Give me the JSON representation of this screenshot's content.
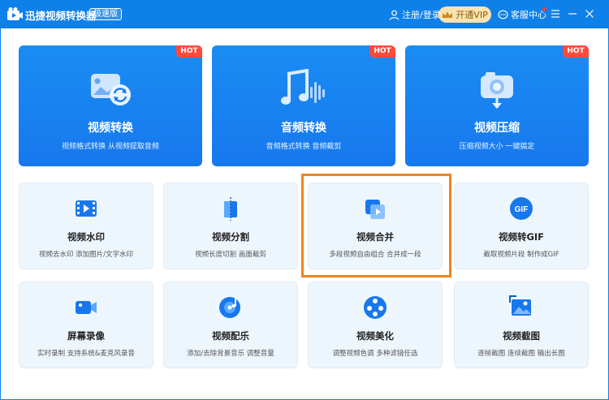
{
  "titlebar": {
    "app_title": "迅捷视频转换器",
    "edition": "极速版",
    "login": "注册/登录",
    "vip": "开通VIP",
    "service": "客服中心"
  },
  "top_cards": [
    {
      "title": "视频转换",
      "desc": "视频格式转换 从视频提取音频",
      "badge": "HOT"
    },
    {
      "title": "音频转换",
      "desc": "音频格式转换 音频截剪",
      "badge": "HOT"
    },
    {
      "title": "视频压缩",
      "desc": "压缩视频大小 一键搞定",
      "badge": "HOT"
    }
  ],
  "tools_row1": [
    {
      "title": "视频水印",
      "desc": "视频去水印 添加图片/文字水印"
    },
    {
      "title": "视频分割",
      "desc": "视频长度切割 画面截剪"
    },
    {
      "title": "视频合并",
      "desc": "多段视频自由组合 合并成一段"
    },
    {
      "title": "视频转GIF",
      "desc": "截取视频片段 制作成GIF"
    }
  ],
  "tools_row2": [
    {
      "title": "屏幕录像",
      "desc": "实时录制 支持系统&麦克风录音"
    },
    {
      "title": "视频配乐",
      "desc": "添加/去除背景音乐 调整音量"
    },
    {
      "title": "视频美化",
      "desc": "调整视频色调 多种滤镜任选"
    },
    {
      "title": "视频截图",
      "desc": "逐帧截图 连续截图 输出长图"
    }
  ],
  "gif_icon_label": "GIF",
  "colors": {
    "brand_blue": "#0e80ea",
    "card_blue": "#1778ee",
    "hot_red": "#ff4a3a",
    "highlight_orange": "#f0851d",
    "vip_gold": "#fbe3b0"
  }
}
